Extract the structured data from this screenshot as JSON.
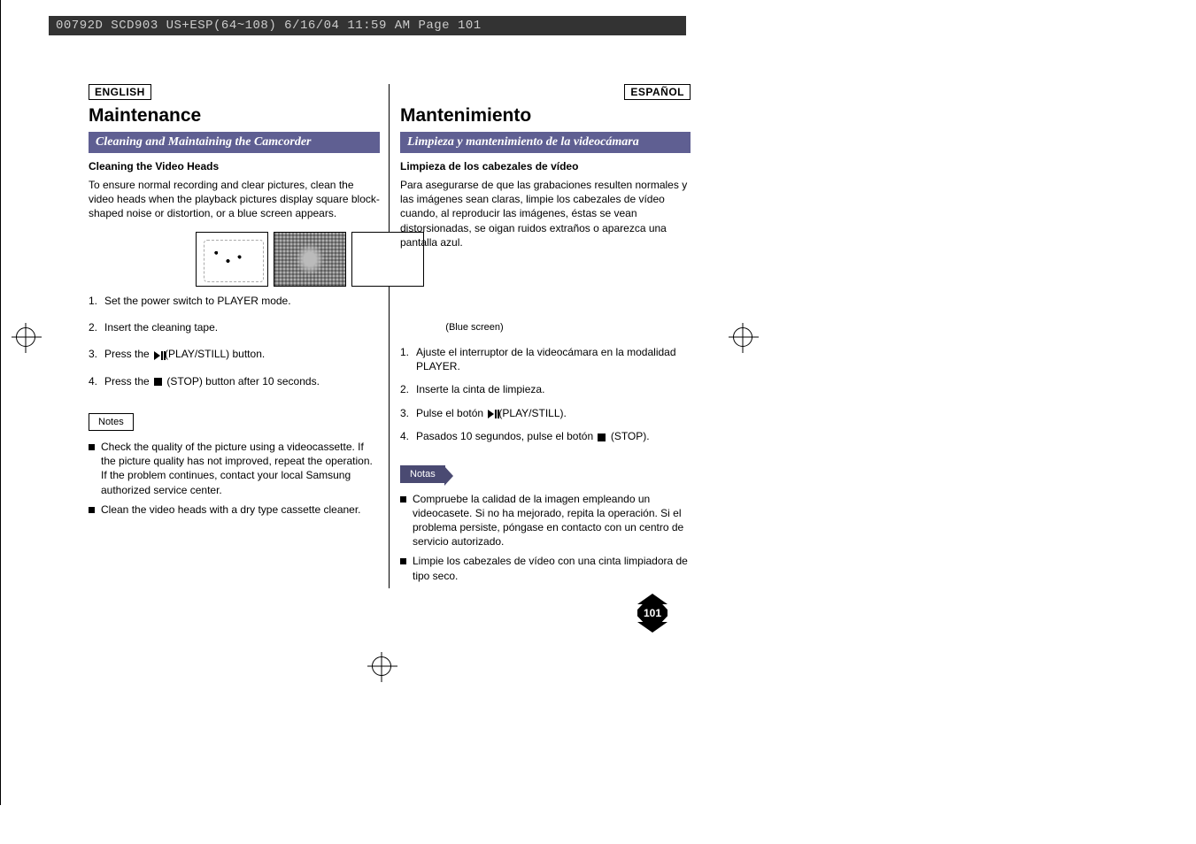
{
  "header_text": "00792D SCD903 US+ESP(64~108)  6/16/04 11:59 AM  Page 101",
  "page_number": "101",
  "left": {
    "lang": "ENGLISH",
    "chapter": "Maintenance",
    "section": "Cleaning and Maintaining the Camcorder",
    "subhead": "Cleaning the Video Heads",
    "intro": "To ensure normal recording and clear pictures, clean the video heads when the playback pictures display square block-shaped noise or distortion, or a blue screen appears.",
    "steps": [
      "Set the power switch to PLAYER mode.",
      "Insert the cleaning tape.",
      "Press the        (PLAY/STILL) button.",
      "Press the      (STOP) button after 10 seconds."
    ],
    "notes_label": "Notes",
    "notes": [
      "Check the quality of the picture using a videocassette. If the picture quality has not improved, repeat the operation. If the problem continues, contact your local Samsung authorized service center.",
      "Clean the video heads with a dry type cassette cleaner."
    ]
  },
  "right": {
    "lang": "ESPAÑOL",
    "chapter": "Mantenimiento",
    "section": "Limpieza y mantenimiento de la videocámara",
    "subhead": "Limpieza de los cabezales de vídeo",
    "intro": "Para asegurarse de que las grabaciones resulten normales y las imágenes sean claras, limpie los cabezales de vídeo cuando, al reproducir las imágenes, éstas se vean distorsionadas, se oigan ruidos extraños o aparezca una pantalla azul.",
    "caption": "(Blue screen)",
    "steps": [
      "Ajuste el interruptor de la videocámara en la modalidad PLAYER.",
      "Inserte la cinta de limpieza.",
      "Pulse el botón        (PLAY/STILL).",
      "Pasados 10 segundos, pulse el botón      (STOP)."
    ],
    "notes_label": "Notas",
    "notes": [
      "Compruebe la calidad de la imagen empleando un videocasete. Si no ha mejorado, repita la operación. Si el problema persiste, póngase en contacto con un centro de servicio autorizado.",
      "Limpie los cabezales de vídeo con una cinta limpiadora de tipo seco."
    ]
  }
}
